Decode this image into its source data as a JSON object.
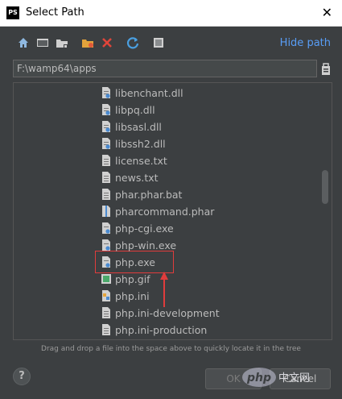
{
  "window": {
    "title": "Select Path",
    "logo_text": "PS"
  },
  "toolbar": {
    "buttons": [
      "home-icon",
      "desktop-icon",
      "project-folder-icon",
      "new-folder-icon",
      "delete-icon",
      "refresh-icon",
      "show-hidden-icon"
    ],
    "hide_path_label": "Hide path"
  },
  "path": {
    "value": "F:\\wamp64\\apps"
  },
  "tree": {
    "items": [
      {
        "label": "libenchant.dll",
        "icon": "dll-file-icon"
      },
      {
        "label": "libpq.dll",
        "icon": "dll-file-icon"
      },
      {
        "label": "libsasl.dll",
        "icon": "dll-file-icon"
      },
      {
        "label": "libssh2.dll",
        "icon": "dll-file-icon"
      },
      {
        "label": "license.txt",
        "icon": "text-file-icon"
      },
      {
        "label": "news.txt",
        "icon": "text-file-icon"
      },
      {
        "label": "phar.phar.bat",
        "icon": "text-file-icon"
      },
      {
        "label": "pharcommand.phar",
        "icon": "archive-file-icon"
      },
      {
        "label": "php-cgi.exe",
        "icon": "exe-file-icon"
      },
      {
        "label": "php-win.exe",
        "icon": "exe-file-icon"
      },
      {
        "label": "php.exe",
        "icon": "exe-file-icon"
      },
      {
        "label": "php.gif",
        "icon": "image-file-icon"
      },
      {
        "label": "php.ini",
        "icon": "ini-file-icon"
      },
      {
        "label": "php.ini-development",
        "icon": "text-file-icon"
      },
      {
        "label": "php.ini-production",
        "icon": "text-file-icon"
      }
    ]
  },
  "hint": "Drag and drop a file into the space above to quickly locate it in the tree",
  "footer": {
    "help_label": "?",
    "ok_label": "OK",
    "cancel_label": "Cancel"
  },
  "watermark": {
    "text": "php",
    "subtext": "中文网"
  },
  "colors": {
    "link": "#589df6",
    "annotation": "#e03c3c",
    "background": "#3c3f41"
  }
}
